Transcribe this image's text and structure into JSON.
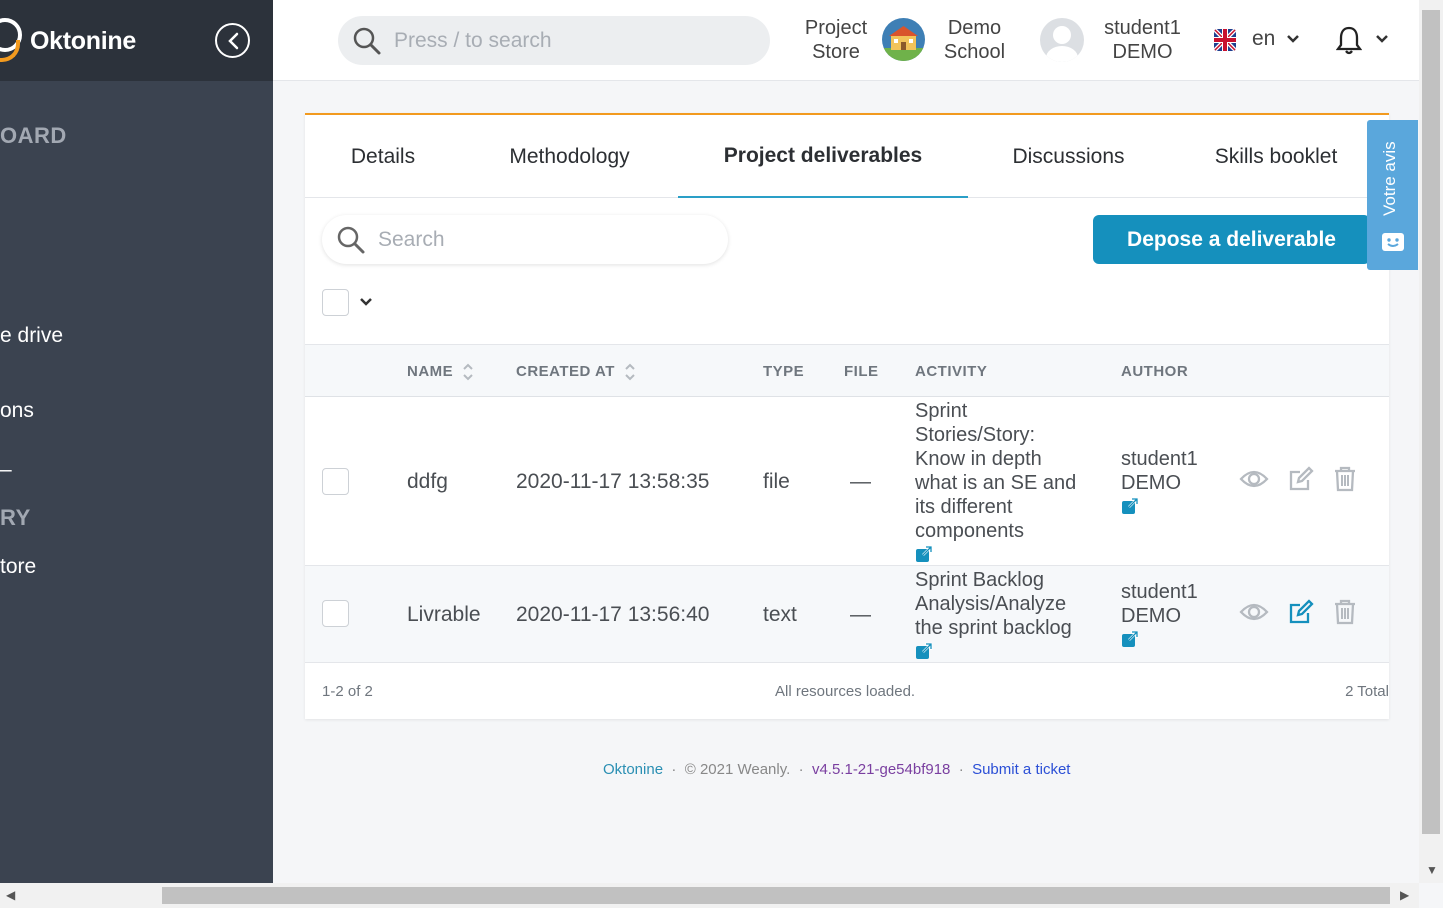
{
  "sidebar": {
    "logo_text": "Oktonine",
    "items": [
      {
        "label": "OARD",
        "kind": "heading"
      },
      {
        "label": "e drive",
        "kind": "link"
      },
      {
        "label": "ons",
        "kind": "link"
      },
      {
        "label": "–",
        "kind": "link"
      },
      {
        "label": "RY",
        "kind": "heading"
      },
      {
        "label": "tore",
        "kind": "link"
      }
    ]
  },
  "topbar": {
    "search_placeholder": "Press / to search",
    "project_store_line1": "Project",
    "project_store_line2": "Store",
    "school_line1": "Demo",
    "school_line2": "School",
    "user_line1": "student1",
    "user_line2": "DEMO",
    "language": "en"
  },
  "tabs": [
    {
      "label": "Details",
      "active": false
    },
    {
      "label": "Methodology",
      "active": false
    },
    {
      "label": "Project deliverables",
      "active": true
    },
    {
      "label": "Discussions",
      "active": false
    },
    {
      "label": "Skills booklet",
      "active": false
    }
  ],
  "deliverables": {
    "search_placeholder": "Search",
    "depose_button": "Depose a deliverable",
    "columns": [
      "NAME",
      "CREATED AT",
      "TYPE",
      "FILE",
      "ACTIVITY",
      "AUTHOR"
    ],
    "rows": [
      {
        "name": "ddfg",
        "created_at": "2020-11-17 13:58:35",
        "type": "file",
        "file": "—",
        "activity_lines": [
          "Sprint",
          "Stories/Story:",
          "Know in depth",
          "what is an SE and",
          "its different",
          "components"
        ],
        "author_line1": "student1",
        "author_line2": "DEMO"
      },
      {
        "name": "Livrable",
        "created_at": "2020-11-17 13:56:40",
        "type": "text",
        "file": "—",
        "activity_lines": [
          "Sprint Backlog",
          "Analysis/Analyze",
          "the sprint backlog"
        ],
        "author_line1": "student1",
        "author_line2": "DEMO"
      }
    ],
    "range": "1-2 of 2",
    "status": "All resources loaded.",
    "total": "2 Total"
  },
  "footer": {
    "brand": "Oktonine",
    "copyright": "© 2021 Weanly.",
    "version": "v4.5.1-21-ge54bf918",
    "ticket": "Submit a ticket"
  },
  "feedback_label": "Votre avis",
  "colors": {
    "sidebar": "#3b4350",
    "accent": "#1590bd",
    "brand_orange": "#f29a1f",
    "feedback": "#5aa7dc"
  }
}
